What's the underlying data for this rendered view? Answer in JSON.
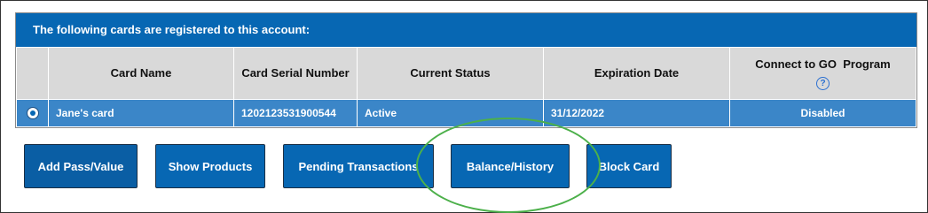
{
  "panel": {
    "header": "The following cards are registered to this account:"
  },
  "table": {
    "columns": {
      "card_name": "Card Name",
      "serial_number": "Card Serial Number",
      "current_status": "Current Status",
      "expiration_date": "Expiration Date",
      "connect_go": "Connect to GO  Program"
    },
    "rows": [
      {
        "selected": true,
        "card_name": "Jane's card",
        "serial_number": "1202123531900544",
        "current_status": "Active",
        "expiration_date": "31/12/2022",
        "connect_go": "Disabled"
      }
    ],
    "help_icon": "question-circle-icon"
  },
  "buttons": {
    "add_pass": "Add Pass/Value",
    "show_products": "Show Products",
    "pending_transactions": "Pending Transactions",
    "balance_history": "Balance/History",
    "block_card": "Block Card"
  },
  "colors": {
    "header_blue": "#0767b3",
    "row_blue": "#3b86c8",
    "highlight_green": "#4cb04a"
  }
}
